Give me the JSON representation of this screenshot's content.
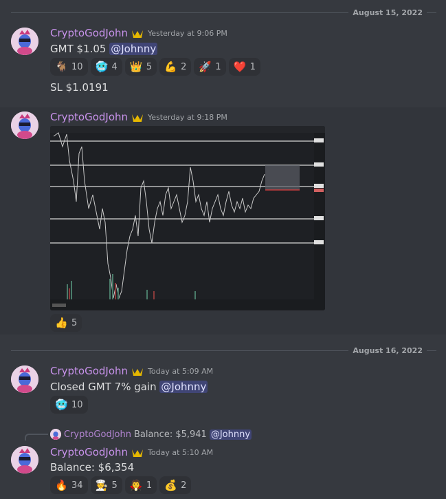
{
  "dividers": [
    {
      "label": "August 15, 2022"
    },
    {
      "label": "August 16, 2022"
    }
  ],
  "messages": [
    {
      "username": "CryptoGodJohn",
      "timestamp": "Yesterday at 9:06 PM",
      "text": "GMT $1.05",
      "mention": "@Johnny",
      "reactions": [
        {
          "emoji": "🐐",
          "count": "10"
        },
        {
          "emoji": "🥶",
          "count": "4"
        },
        {
          "emoji": "👑",
          "count": "5"
        },
        {
          "emoji": "💪",
          "count": "2"
        },
        {
          "emoji": "🚀",
          "count": "1"
        },
        {
          "emoji": "❤️",
          "count": "1"
        }
      ],
      "followup": "SL $1.0191"
    },
    {
      "username": "CryptoGodJohn",
      "timestamp": "Yesterday at 9:18 PM",
      "reactions": [
        {
          "emoji": "👍",
          "count": "5"
        }
      ]
    },
    {
      "username": "CryptoGodJohn",
      "timestamp": "Today at 5:09 AM",
      "text": "Closed GMT 7% gain",
      "mention": "@Johnny",
      "reactions": [
        {
          "emoji": "🥶",
          "count": "10"
        }
      ]
    },
    {
      "username": "CryptoGodJohn",
      "timestamp": "Today at 5:10 AM",
      "reply": {
        "username": "CryptoGodJohn",
        "text": "Balance: $5,941",
        "mention": "@Johnny"
      },
      "text": "Balance: $6,354",
      "reactions": [
        {
          "emoji": "🔥",
          "count": "34"
        },
        {
          "emoji": "🧑‍🍳",
          "count": "5"
        },
        {
          "emoji": "🧛",
          "count": "1"
        },
        {
          "emoji": "💰",
          "count": "2"
        }
      ]
    }
  ],
  "colors": {
    "background": "#36393f",
    "username": "#c792ea",
    "mention_bg": "#414774",
    "reaction_bg": "#2f3136",
    "crown": "#e6b800"
  }
}
